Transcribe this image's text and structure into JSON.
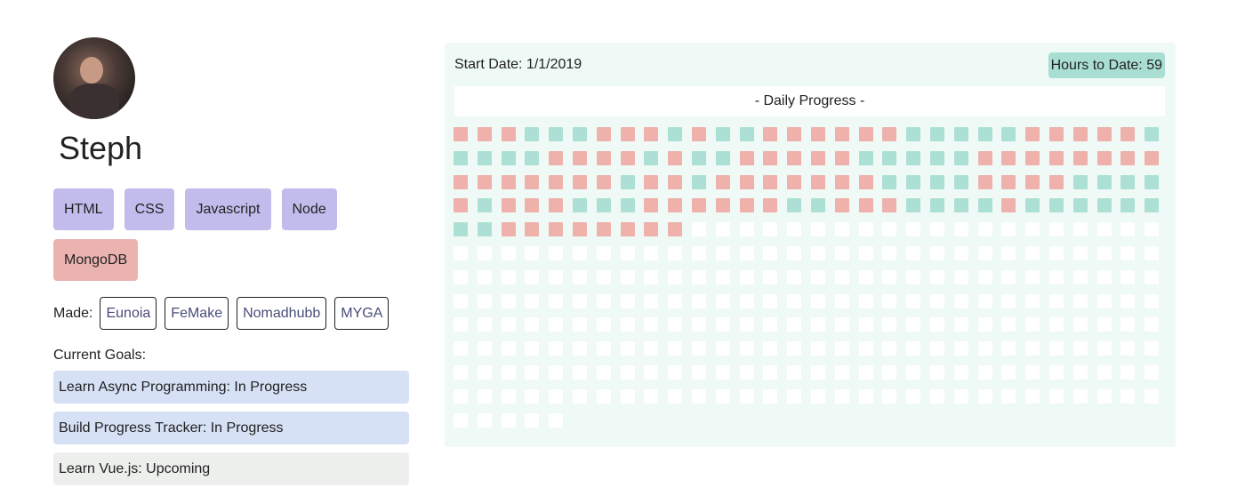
{
  "profile": {
    "name": "Steph",
    "avatar": "profile-photo"
  },
  "skills": [
    {
      "label": "HTML",
      "variant": "purple"
    },
    {
      "label": "CSS",
      "variant": "purple"
    },
    {
      "label": "Javascript",
      "variant": "purple"
    },
    {
      "label": "Node",
      "variant": "purple"
    },
    {
      "label": "MongoDB",
      "variant": "pink"
    }
  ],
  "made": {
    "label": "Made:",
    "projects": [
      "Eunoia",
      "FeMake",
      "Nomadhubb",
      "MYGA"
    ]
  },
  "goals": {
    "label": "Current Goals:",
    "items": [
      {
        "text": "Learn Async Programming: In Progress",
        "status": "progress"
      },
      {
        "text": "Build Progress Tracker: In Progress",
        "status": "progress"
      },
      {
        "text": "Learn Vue.js: Upcoming",
        "status": "upcoming"
      }
    ]
  },
  "tracker": {
    "start_date": "Start Date: 1/1/2019",
    "hours": "Hours to Date: 59",
    "title": "- Daily Progress -",
    "total_days": 365,
    "colors": {
      "red": "#eeb1ab",
      "teal": "#ade0d5",
      "empty": "#ffffff"
    },
    "days": "RRRTTTRRRTRTTRRRRRRTTTTTRRRRRTTTTTRRRRTRTTRRRRRTTTTTRRRRRRRRRRRRRRRTRRTRRRRRRRTTTTRRRRTTTTRTRRRTTTRRRRRRTTRRRTTTTRTTTTTTTTRRRRRRRR"
  }
}
